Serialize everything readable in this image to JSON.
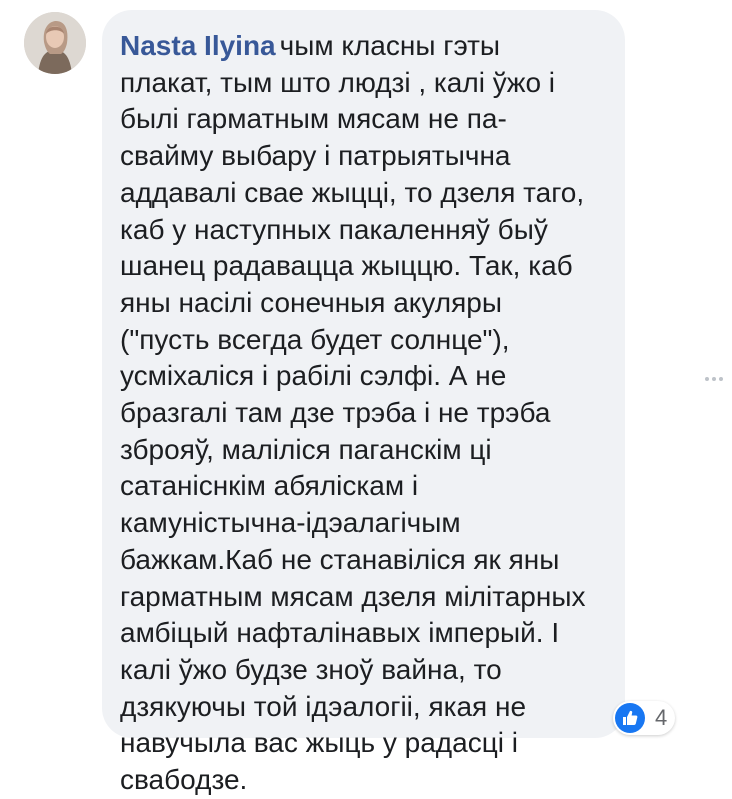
{
  "comment": {
    "author": "Nasta Ilyina",
    "lines": [
      "чым класны гэты",
      "плакат, тым што людзі , калі ўжо і",
      "былі гарматным мясам не па-",
      "свайму выбару і патрыятычна",
      "аддавалі свае жыцці, то дзеля таго,",
      "каб у наступных пакаленняў быў",
      "шанец радавацца жыццю. Так, каб",
      "яны насілі сонечныя акуляры",
      "(\"пусть всегда будет солнце\"),",
      "усміхаліся і рабілі сэлфі. А не",
      "бразгалі там дзе трэба і не трэба",
      "зброяў, маліліся паганскім ці",
      "сатаніснкім абялiскам і",
      "камуністычна-ідэалагічым",
      "бажкам.Каб не станавіліся як яны",
      "гарматным мясам дзеля мілітарных",
      "амбіцый нафталінавых імперый. І",
      "калі ўжо будзе зноў вайна, то",
      "дзякуючы той ідэалогіі, якая не",
      "навучыла вас жыць у радасці і",
      "свабодзе."
    ],
    "reactions": {
      "icon": "like-icon",
      "count": "4"
    }
  },
  "colors": {
    "author": "#385898",
    "bubble": "#f0f2f5",
    "text": "#1c1e21",
    "like": "#1877f2"
  }
}
